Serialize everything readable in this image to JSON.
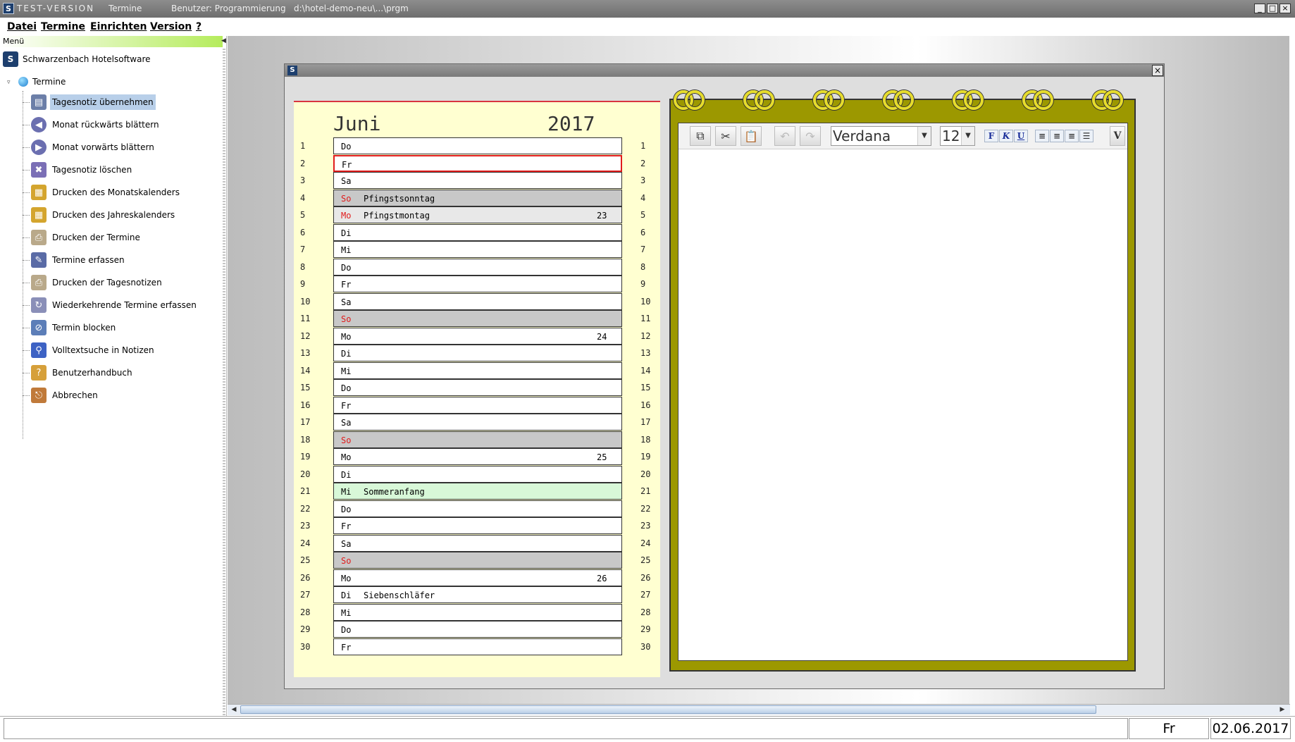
{
  "window": {
    "mode_label": "TEST-VERSION",
    "module": "Termine",
    "user": "Benutzer: Programmierung",
    "path": "d:\\hotel-demo-neu\\...\\prgm"
  },
  "menubar": [
    "Datei",
    "Termine",
    "Einrichten",
    "Version",
    "?"
  ],
  "sidebar": {
    "header": "Menü",
    "root_label": "Schwarzenbach Hotelsoftware",
    "group_label": "Termine",
    "items": [
      {
        "label": "Tagesnotiz übernehmen",
        "icon": "save-note-icon",
        "selected": true
      },
      {
        "label": "Monat rückwärts blättern",
        "icon": "arrow-left-icon"
      },
      {
        "label": "Monat vorwärts blättern",
        "icon": "arrow-right-icon"
      },
      {
        "label": "Tagesnotiz löschen",
        "icon": "delete-note-icon"
      },
      {
        "label": "Drucken des Monatskalenders",
        "icon": "print-calendar-icon"
      },
      {
        "label": "Drucken des Jahreskalenders",
        "icon": "print-calendar-icon"
      },
      {
        "label": "Drucken der Termine",
        "icon": "print-icon"
      },
      {
        "label": "Termine erfassen",
        "icon": "appointment-edit-icon"
      },
      {
        "label": "Drucken der Tagesnotizen",
        "icon": "print-icon"
      },
      {
        "label": "Wiederkehrende Termine erfassen",
        "icon": "recurring-appointment-icon"
      },
      {
        "label": "Termin blocken",
        "icon": "block-appointment-icon"
      },
      {
        "label": "Volltextsuche in Notizen",
        "icon": "search-icon"
      },
      {
        "label": "Benutzerhandbuch",
        "icon": "help-icon"
      },
      {
        "label": "Abbrechen",
        "icon": "exit-icon"
      }
    ]
  },
  "calendar": {
    "month": "Juni",
    "year": "2017",
    "days": [
      {
        "d": "1",
        "wd": "Do"
      },
      {
        "d": "2",
        "wd": "Fr",
        "selected": true
      },
      {
        "d": "3",
        "wd": "Sa"
      },
      {
        "d": "4",
        "wd": "So",
        "note": "Pfingstsonntag",
        "sun": true
      },
      {
        "d": "5",
        "wd": "Mo",
        "note": "Pfingstmontag",
        "week": "23",
        "holiday": true
      },
      {
        "d": "6",
        "wd": "Di"
      },
      {
        "d": "7",
        "wd": "Mi"
      },
      {
        "d": "8",
        "wd": "Do"
      },
      {
        "d": "9",
        "wd": "Fr"
      },
      {
        "d": "10",
        "wd": "Sa"
      },
      {
        "d": "11",
        "wd": "So",
        "sun": true
      },
      {
        "d": "12",
        "wd": "Mo",
        "week": "24"
      },
      {
        "d": "13",
        "wd": "Di"
      },
      {
        "d": "14",
        "wd": "Mi"
      },
      {
        "d": "15",
        "wd": "Do"
      },
      {
        "d": "16",
        "wd": "Fr"
      },
      {
        "d": "17",
        "wd": "Sa"
      },
      {
        "d": "18",
        "wd": "So",
        "sun": true
      },
      {
        "d": "19",
        "wd": "Mo",
        "week": "25"
      },
      {
        "d": "20",
        "wd": "Di"
      },
      {
        "d": "21",
        "wd": "Mi",
        "note": "Sommeranfang",
        "season": true
      },
      {
        "d": "22",
        "wd": "Do"
      },
      {
        "d": "23",
        "wd": "Fr"
      },
      {
        "d": "24",
        "wd": "Sa"
      },
      {
        "d": "25",
        "wd": "So",
        "sun": true
      },
      {
        "d": "26",
        "wd": "Mo",
        "week": "26"
      },
      {
        "d": "27",
        "wd": "Di",
        "note": "Siebenschläfer"
      },
      {
        "d": "28",
        "wd": "Mi"
      },
      {
        "d": "29",
        "wd": "Do"
      },
      {
        "d": "30",
        "wd": "Fr"
      }
    ]
  },
  "editor": {
    "font": "Verdana",
    "size": "12",
    "format_buttons": [
      "F",
      "K",
      "U"
    ],
    "more_label": "V",
    "icons": [
      "copy-icon",
      "cut-icon",
      "paste-icon",
      "undo-icon",
      "redo-icon"
    ]
  },
  "status": {
    "weekday": "Fr",
    "date": "02.06.2017"
  },
  "colors": {
    "sunday_red": "#e01c1c",
    "notepad_olive": "#9c9800",
    "calendar_bg": "#ffffd1",
    "selection_blue": "#b8cfe9"
  }
}
